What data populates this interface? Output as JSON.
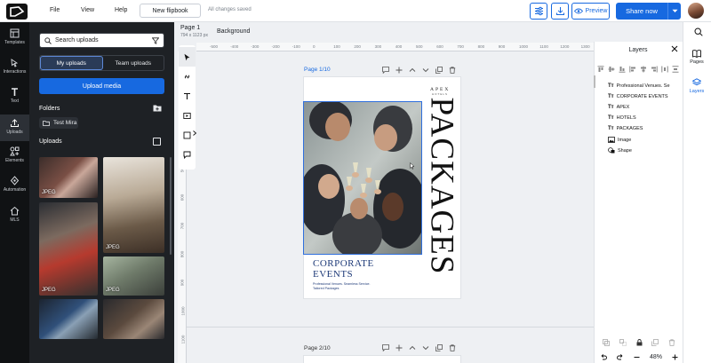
{
  "topbar": {
    "menu": [
      "File",
      "View",
      "Help"
    ],
    "new_flipbook": "New flipbook",
    "status": "All changes saved",
    "preview": "Preview",
    "share_now": "Share now"
  },
  "rail": {
    "items": [
      {
        "label": "Templates",
        "icon": "templates-icon"
      },
      {
        "label": "Interactions",
        "icon": "interactions-icon"
      },
      {
        "label": "Text",
        "icon": "text-icon"
      },
      {
        "label": "Uploads",
        "icon": "uploads-icon"
      },
      {
        "label": "Elements",
        "icon": "elements-icon"
      },
      {
        "label": "Automation",
        "icon": "automation-icon"
      },
      {
        "label": "MLS",
        "icon": "mls-icon"
      }
    ]
  },
  "uploads_panel": {
    "search_placeholder": "Search uploads",
    "tabs": [
      "My uploads",
      "Team uploads"
    ],
    "upload_button": "Upload media",
    "folders_heading": "Folders",
    "folder": "Test Mira",
    "uploads_heading": "Uploads",
    "badge": "JPEG"
  },
  "page_header": {
    "name": "Page 1",
    "size": "794 x 1123 px",
    "background": "Background"
  },
  "rulers": {
    "h": [
      "-500",
      "-400",
      "-300",
      "-200",
      "-100",
      "0",
      "100",
      "200",
      "300",
      "400",
      "500",
      "600",
      "700",
      "800",
      "900",
      "1000",
      "1100",
      "1200",
      "1300"
    ],
    "v": [
      "500",
      "600",
      "700",
      "800",
      "900",
      "1000",
      "1100",
      "1200"
    ]
  },
  "pages": [
    {
      "label": "Page 1/10"
    },
    {
      "label": "Page 2/10"
    }
  ],
  "design": {
    "brand": "APEX",
    "brand_sub": "HOTELS",
    "vertical_title": "PACKAGES",
    "title_line1": "CORPORATE",
    "title_line2": "EVENTS",
    "tagline1": "Professional Venues. Seamless Service.",
    "tagline2": "Tailored Packages"
  },
  "layers": {
    "title": "Layers",
    "items": [
      {
        "type": "text",
        "name": "Professional Venues. Se"
      },
      {
        "type": "text",
        "name": "CORPORATE EVENTS"
      },
      {
        "type": "text",
        "name": "APEX"
      },
      {
        "type": "text",
        "name": "HOTELS"
      },
      {
        "type": "text",
        "name": "PACKAGES"
      },
      {
        "type": "image",
        "name": "Image"
      },
      {
        "type": "shape",
        "name": "Shape"
      }
    ],
    "text_badge": "Tт",
    "zoom": "48%"
  },
  "right_rail": {
    "pages": "Pages",
    "layers": "Layers"
  },
  "colors": {
    "accent": "#1769e0",
    "title_navy": "#1e3a78",
    "dark_panel": "#1e2125"
  }
}
